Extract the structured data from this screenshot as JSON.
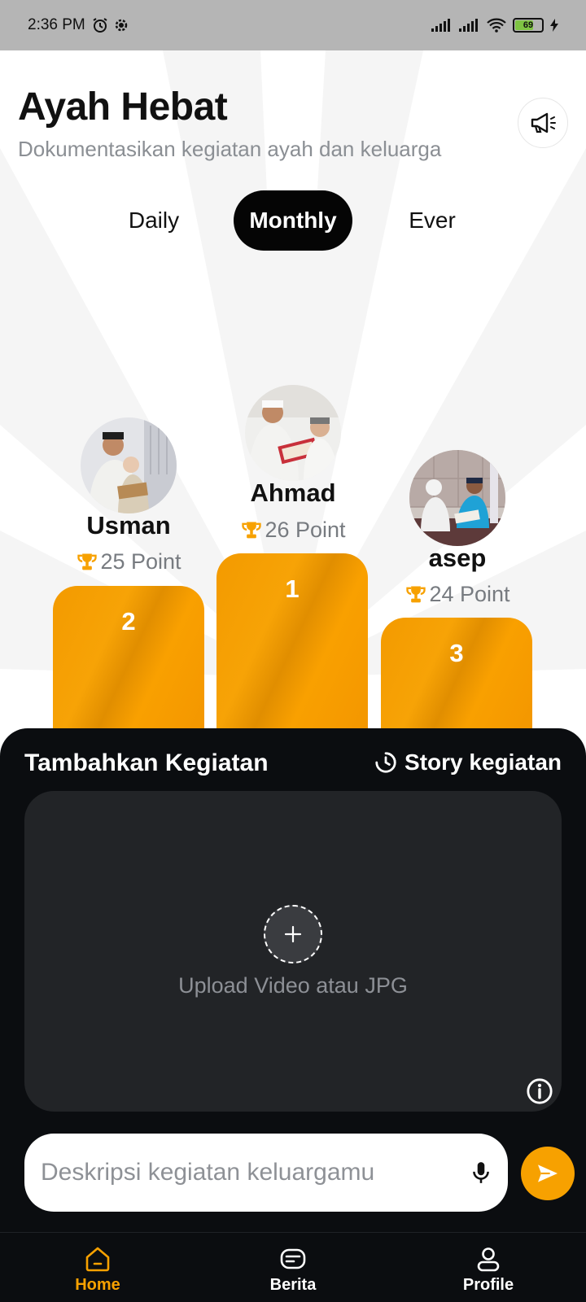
{
  "status_bar": {
    "time": "2:36 PM",
    "battery": "69"
  },
  "header": {
    "title": "Ayah Hebat",
    "subtitle": "Dokumentasikan kegiatan ayah dan keluarga"
  },
  "tabs": [
    {
      "label": "Daily",
      "active": false
    },
    {
      "label": "Monthly",
      "active": true
    },
    {
      "label": "Ever",
      "active": false
    }
  ],
  "leaderboard": [
    {
      "rank": "1",
      "name": "Ahmad",
      "points": "26 Point"
    },
    {
      "rank": "2",
      "name": "Usman",
      "points": "25 Point"
    },
    {
      "rank": "3",
      "name": "asep",
      "points": "24 Point"
    }
  ],
  "panel": {
    "title": "Tambahkan Kegiatan",
    "story_label": "Story kegiatan",
    "upload_label": "Upload Video atau JPG",
    "description_placeholder": "Deskripsi kegiatan keluargamu"
  },
  "nav": [
    {
      "label": "Home",
      "icon": "home-icon",
      "active": true
    },
    {
      "label": "Berita",
      "icon": "news-icon",
      "active": false
    },
    {
      "label": "Profile",
      "icon": "profile-icon",
      "active": false
    }
  ],
  "colors": {
    "accent": "#f7a100",
    "dark": "#0b0d10",
    "subtitle": "#8b8f94"
  }
}
